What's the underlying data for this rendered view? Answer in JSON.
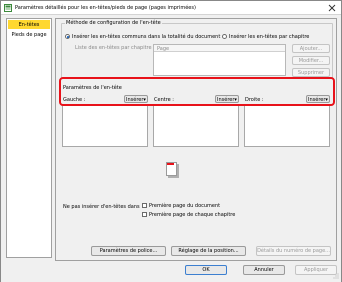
{
  "window": {
    "title": "Paramètres détaillés pour les en-têtes/pieds de page (pages imprimées)"
  },
  "nav": {
    "items": [
      {
        "label": "En-têtes",
        "selected": true
      },
      {
        "label": "Pieds de page",
        "selected": false
      }
    ]
  },
  "method": {
    "group_title": "Méthode de configuration de l'en-tête",
    "option_common": "Insérer les en-têtes communs dans la totalité du document",
    "option_per_chapter": "Insérer les en-têtes par chapitre",
    "list_label": "Liste des en-têtes par chapitre :",
    "list_header": "Page",
    "btn_add": "Ajouter...",
    "btn_edit": "Modifier...",
    "btn_delete": "Supprimer"
  },
  "header_params": {
    "title": "Paramètres de l'en-tête",
    "left_label": "Gauche :",
    "center_label": "Centre :",
    "right_label": "Droite :",
    "insert_label": "Insérer▾"
  },
  "no_insert": {
    "label": "Ne pas insérer d'en-têtes dans",
    "opt_first_doc": "Première page du document",
    "opt_first_chapter": "Première page de chaque chapitre"
  },
  "buttons": {
    "font": "Paramètres de police...",
    "position": "Réglage de la position...",
    "page_number": "Détails du numéro de page...",
    "ok": "OK",
    "cancel": "Annuler",
    "apply": "Appliquer"
  },
  "colors": {
    "highlight": "#e8121a",
    "selected_nav": "#ffd830",
    "radio_dot": "#1a5fb4"
  }
}
